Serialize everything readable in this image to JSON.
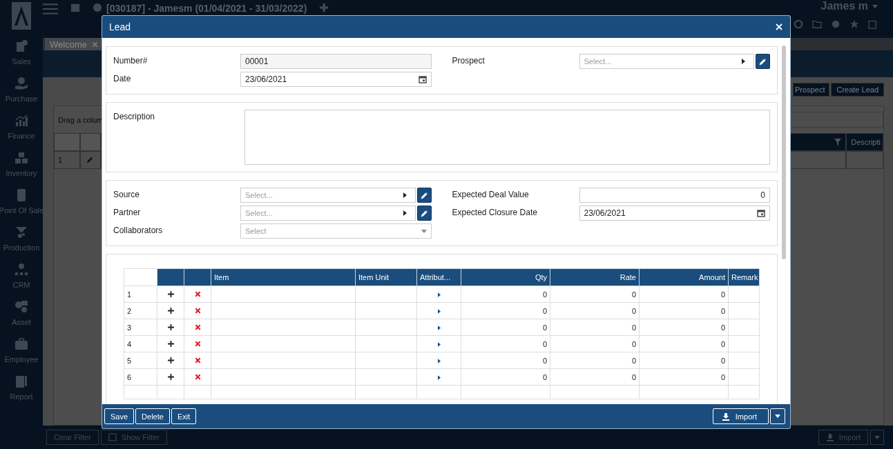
{
  "app": {
    "header": {
      "title": "[030187] - Jamesm (01/04/2021 - 31/03/2022)",
      "user": "James m"
    },
    "sidebar": {
      "items": [
        {
          "label": "Sales"
        },
        {
          "label": "Purchase"
        },
        {
          "label": "Finance"
        },
        {
          "label": "Inventory"
        },
        {
          "label": "Point Of Sale"
        },
        {
          "label": "Production"
        },
        {
          "label": "CRM"
        },
        {
          "label": "Asset"
        },
        {
          "label": "Employee"
        },
        {
          "label": "Report"
        }
      ]
    },
    "tabs": [
      {
        "label": "Welcome",
        "selected": true
      }
    ],
    "toolbar": {
      "buttons": [
        "Prospect",
        "Create Lead"
      ]
    },
    "grid": {
      "hint": "Drag a colum",
      "last_column": "Descripti",
      "rows": [
        {
          "no": "1"
        }
      ]
    },
    "bottom_bar": {
      "buttons": [
        "Clear Filter",
        "Show Filter"
      ],
      "import": "Import"
    }
  },
  "dialog": {
    "title": "Lead",
    "sections": [
      {
        "left": [
          {
            "label": "Number#",
            "value": "00001",
            "kind": "readonly"
          },
          {
            "label": "Date",
            "value": "23/06/2021",
            "kind": "date"
          }
        ],
        "right": [
          {
            "label": "Prospect",
            "placeholder": "Select...",
            "kind": "lookup"
          }
        ]
      },
      {
        "left": [
          {
            "label": "Description",
            "kind": "textarea"
          }
        ]
      },
      {
        "left": [
          {
            "label": "Source",
            "placeholder": "Select...",
            "kind": "lookup"
          },
          {
            "label": "Partner",
            "placeholder": "Select...",
            "kind": "lookup"
          },
          {
            "label": "Collaborators",
            "placeholder": "Select",
            "kind": "dropdown"
          }
        ],
        "right": [
          {
            "label": "Expected Deal Value",
            "value": "0",
            "kind": "number"
          },
          {
            "label": "Expected Closure Date",
            "value": "23/06/2021",
            "kind": "date"
          }
        ]
      }
    ],
    "lines": {
      "columns": [
        {
          "label": "Item",
          "kind": "item"
        },
        {
          "label": "Item Unit",
          "kind": "unit"
        },
        {
          "label": "Attribut...",
          "kind": "attribute"
        },
        {
          "label": "Qty",
          "kind": "qty"
        },
        {
          "label": "Rate",
          "kind": "rate"
        },
        {
          "label": "Amount",
          "kind": "amount"
        },
        {
          "label": "Remark",
          "kind": "remark"
        }
      ],
      "rows": [
        {
          "no": "1",
          "qty": "0",
          "rate": "0",
          "amount": "0"
        },
        {
          "no": "2",
          "qty": "0",
          "rate": "0",
          "amount": "0"
        },
        {
          "no": "3",
          "qty": "0",
          "rate": "0",
          "amount": "0"
        },
        {
          "no": "4",
          "qty": "0",
          "rate": "0",
          "amount": "0"
        },
        {
          "no": "5",
          "qty": "0",
          "rate": "0",
          "amount": "0"
        },
        {
          "no": "6",
          "qty": "0",
          "rate": "0",
          "amount": "0"
        }
      ]
    },
    "buttons": [
      "Save",
      "Delete",
      "Exit"
    ],
    "import": "Import"
  }
}
